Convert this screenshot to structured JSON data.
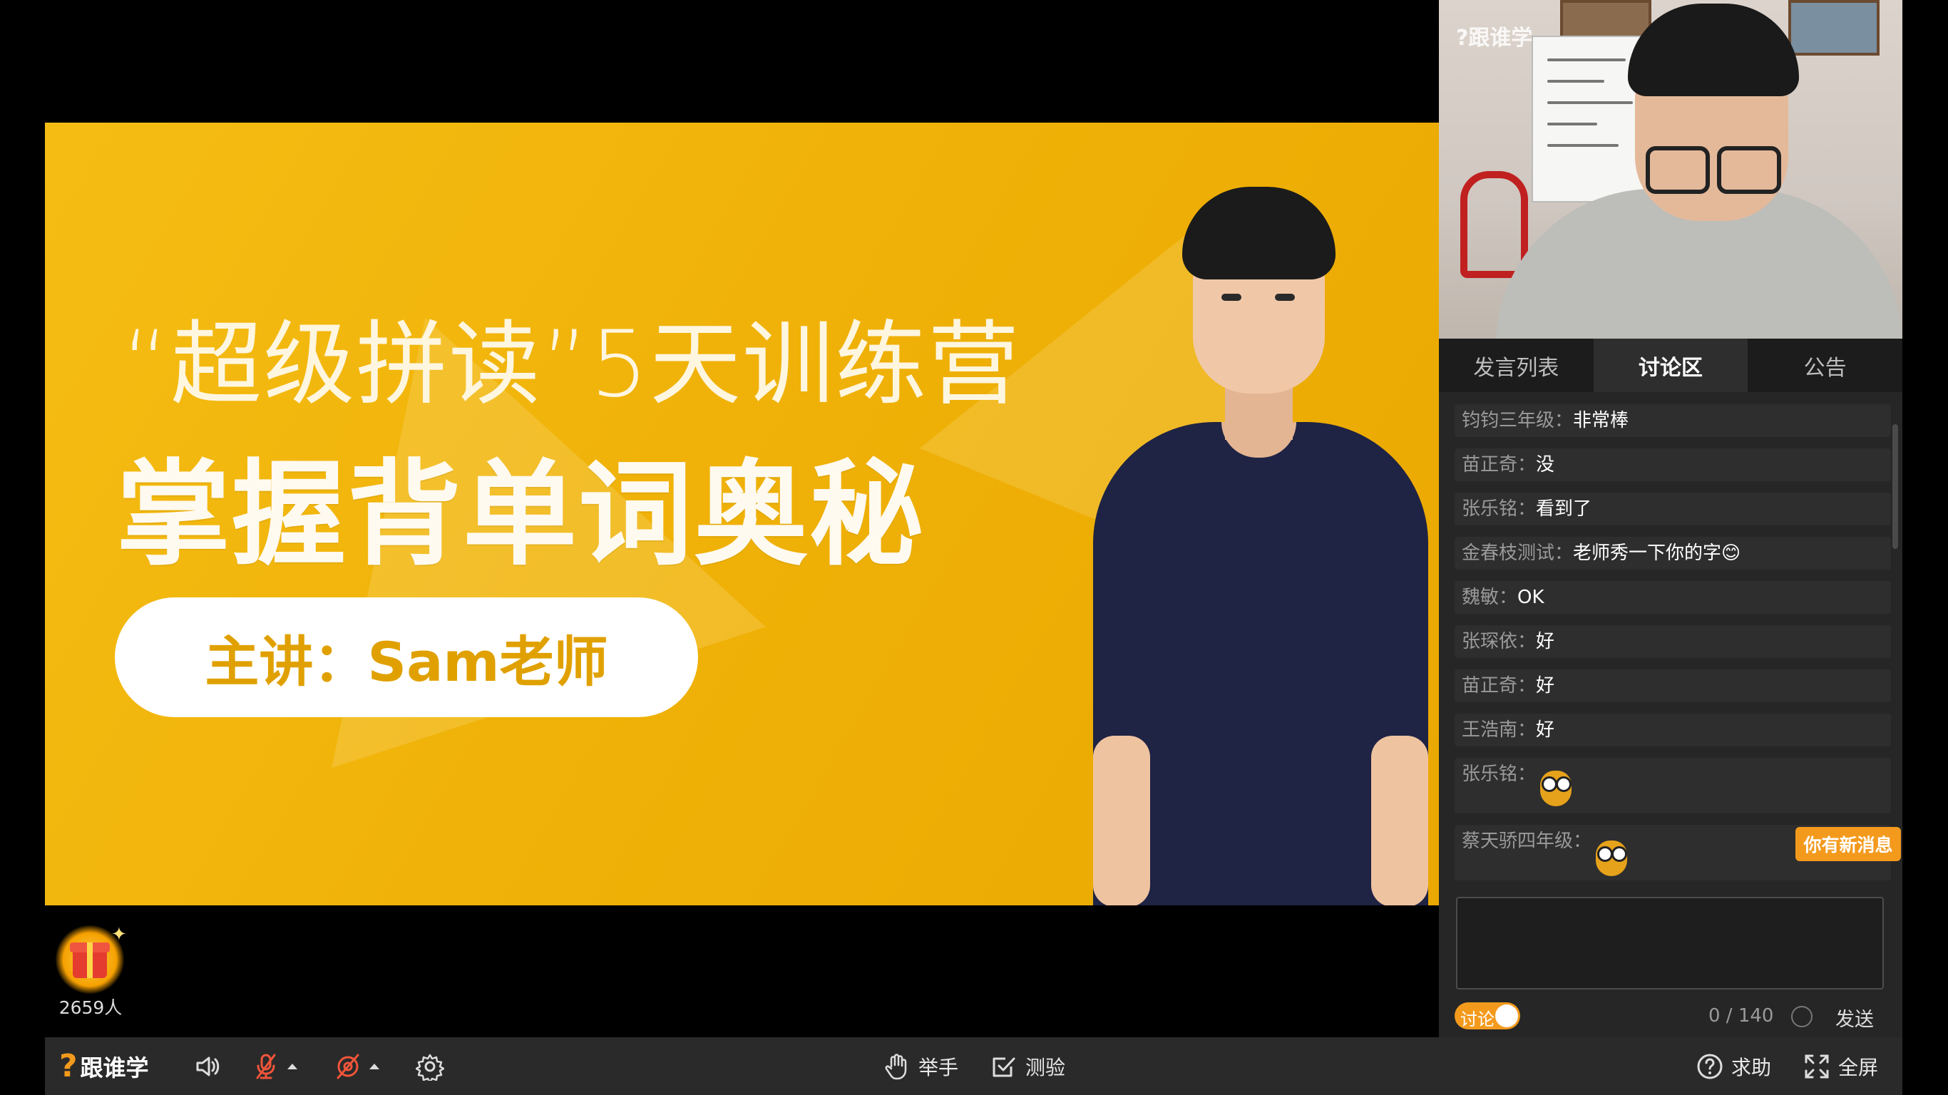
{
  "slide": {
    "title": "“超级拼读”5天训练营",
    "headline": "掌握背单词奥秘",
    "speaker": "主讲：Sam老师"
  },
  "webcam": {
    "logo": "?跟谁学"
  },
  "chat": {
    "tabs": [
      {
        "label": "发言列表",
        "active": false
      },
      {
        "label": "讨论区",
        "active": true
      },
      {
        "label": "公告",
        "active": false
      }
    ],
    "messages": [
      {
        "name": "钧钧三年级：",
        "text": "非常棒"
      },
      {
        "name": "苗正奇：",
        "text": "没"
      },
      {
        "name": "张乐铭：",
        "text": "看到了"
      },
      {
        "name": "金春枝测试：",
        "text": "老师秀一下你的字😊"
      },
      {
        "name": "魏敏：",
        "text": "OK"
      },
      {
        "name": "张琛依：",
        "text": "好"
      },
      {
        "name": "苗正奇：",
        "text": "好"
      },
      {
        "name": "王浩南：",
        "text": "好"
      },
      {
        "name": "张乐铭：",
        "text": "",
        "sticker": "owl-sticker"
      },
      {
        "name": "蔡天骄四年级：",
        "text": "",
        "sticker": "owl-sticker"
      }
    ],
    "new_message_badge": "你有新消息",
    "input_value": "",
    "toggle_label": "讨论",
    "char_count": "0 / 140",
    "send_label": "发送"
  },
  "gift": {
    "viewers": "2659人"
  },
  "toolbar": {
    "brand": "跟谁学",
    "raise_hand": "举手",
    "quiz": "测验",
    "help": "求助",
    "fullscreen": "全屏"
  },
  "colors": {
    "accent": "#f39a1d",
    "slide_bg": "#f0b208",
    "panel_bg": "#262626"
  }
}
